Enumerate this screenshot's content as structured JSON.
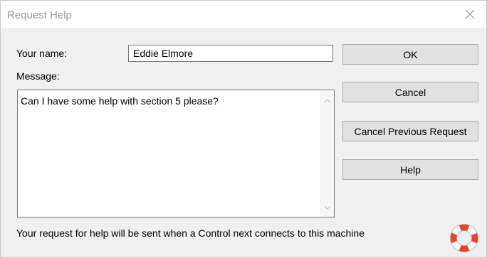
{
  "window": {
    "title": "Request Help",
    "close_icon": "close-icon"
  },
  "form": {
    "name_label": "Your name:",
    "name_value": "Eddie Elmore",
    "message_label": "Message:",
    "message_value": "Can I have some help with section 5 please?"
  },
  "buttons": {
    "ok": "OK",
    "cancel": "Cancel",
    "cancel_previous": "Cancel Previous Request",
    "help": "Help"
  },
  "footer": {
    "info": "Your request for help will be sent when a Control next connects to this machine",
    "icon": "lifebuoy-icon"
  },
  "colors": {
    "button_bg": "#e1e1e1",
    "button_border": "#adadad",
    "window_bg": "#f0f0f0",
    "lifebuoy_red": "#e8432b"
  }
}
